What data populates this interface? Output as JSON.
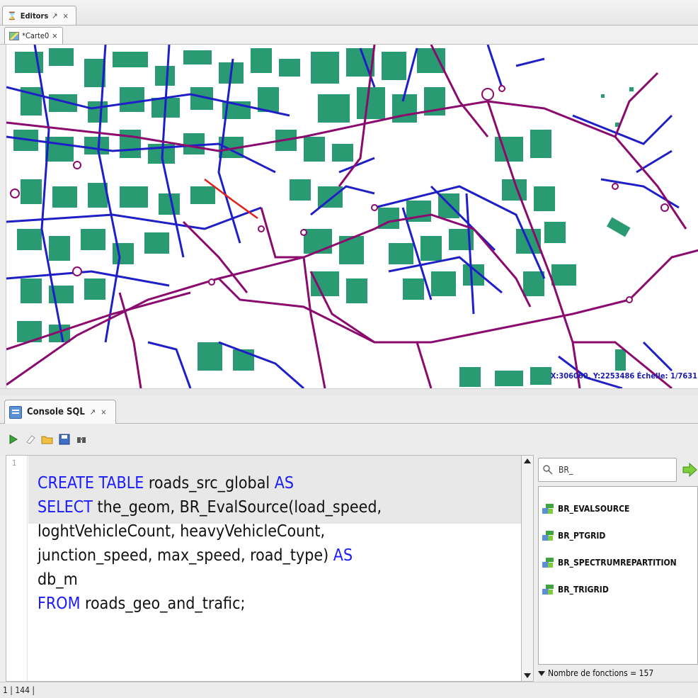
{
  "editors": {
    "panel_title": "Editors",
    "panel_controls": "↗ ×",
    "doc_tab_label": "*Carte0",
    "doc_tab_close": "×"
  },
  "map": {
    "coordinate_readout": "X:306060, Y:2253486 Échelle: 1/7631",
    "colors": {
      "buildings": "#2a9a72",
      "roads_local": "#1f1fc8",
      "roads_main": "#8b0a6e",
      "highlight": "#e0201a",
      "background": "#ffffff"
    }
  },
  "console": {
    "panel_title": "Console SQL",
    "panel_controls": "↗ ×",
    "toolbar": [
      "execute-icon",
      "clear-icon",
      "open-icon",
      "save-icon",
      "find-icon"
    ],
    "line_number": "1",
    "code_tokens": {
      "l1_kw1": "CREATE TABLE",
      "l1_txt": " roads_src_global ",
      "l1_kw2": "AS",
      "l2_kw": "SELECT",
      "l2_txt": " the_geom, BR_EvalSource(load_speed,",
      "l3_txt": "loghtVehicleCount, heavyVehicleCount,",
      "l4_txt": "junction_speed, max_speed, road_type) ",
      "l4_kw": "AS",
      "l5_txt": "db_m",
      "l6_kw": "FROM",
      "l6_txt": " roads_geo_and_trafic;"
    },
    "keyword_color": "#1a1aff"
  },
  "functions": {
    "search_value": "BR_",
    "items": [
      "BR_EVALSOURCE",
      "BR_PTGRID",
      "BR_SPECTRUMREPARTITION",
      "BR_TRIGRID"
    ],
    "count_label": "Nombre de fonctions = 157"
  },
  "status": {
    "text": "1 | 144 |"
  }
}
